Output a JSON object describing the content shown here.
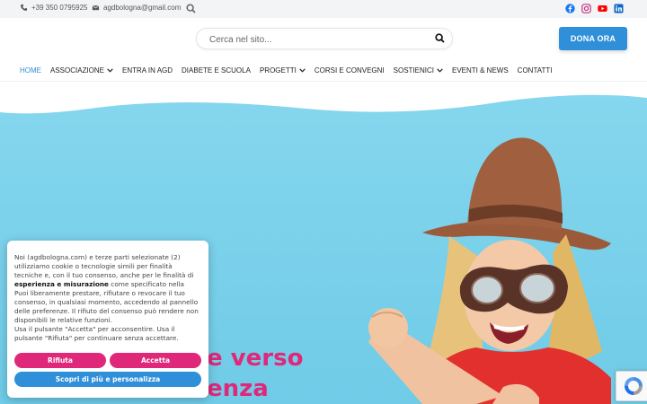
{
  "topbar": {
    "phone": "+39 350 0795925",
    "email": "agdbologna@gmail.com",
    "social": [
      {
        "name": "facebook-icon",
        "color": "#1877f2"
      },
      {
        "name": "instagram-icon",
        "color": "#c13584"
      },
      {
        "name": "youtube-icon",
        "color": "#ff0000"
      },
      {
        "name": "linkedin-icon",
        "color": "#0a66c2"
      }
    ]
  },
  "header": {
    "search_placeholder": "Cerca nel sito...",
    "donate_label": "DONA ORA"
  },
  "nav": {
    "items": [
      {
        "label": "HOME",
        "active": true
      },
      {
        "label": "ASSOCIAZIONE",
        "dropdown": true
      },
      {
        "label": "ENTRA IN AGD"
      },
      {
        "label": "DIABETE E SCUOLA"
      },
      {
        "label": "PROGETTI",
        "dropdown": true
      },
      {
        "label": "CORSI E CONVEGNI"
      },
      {
        "label": "SOSTIENICI",
        "dropdown": true
      },
      {
        "label": "EVENTI & NEWS"
      },
      {
        "label": "CONTATTI"
      }
    ]
  },
  "hero": {
    "headline_line1": "e verso",
    "headline_line2": "enza",
    "colors": {
      "sky": "#7fd3ec",
      "accent": "#e0287a"
    }
  },
  "cookie": {
    "p1_a": "Noi (agdbologna.com) e terze parti selezionate (2) utilizziamo cookie o tecnologie simili per finalità tecniche e, con il tuo consenso, anche per le finalità di ",
    "p1_bold": "esperienza e misurazione",
    "p1_b": " come specificato nella",
    "p2": "Puoi liberamente prestare, rifiutare o revocare il tuo consenso, in qualsiasi momento, accedendo al pannello delle preferenze. Il rifiuto del consenso può rendere non disponibili le relative funzioni.",
    "p3": "Usa il pulsante \"Accetta\" per acconsentire. Usa il pulsante \"Rifiuta\" per continuare senza accettare.",
    "reject_label": "Rifiuta",
    "accept_label": "Accetta",
    "more_label": "Scopri di più e personalizza",
    "colors": {
      "primary": "#e0287a",
      "secondary": "#2f8fd8"
    }
  }
}
